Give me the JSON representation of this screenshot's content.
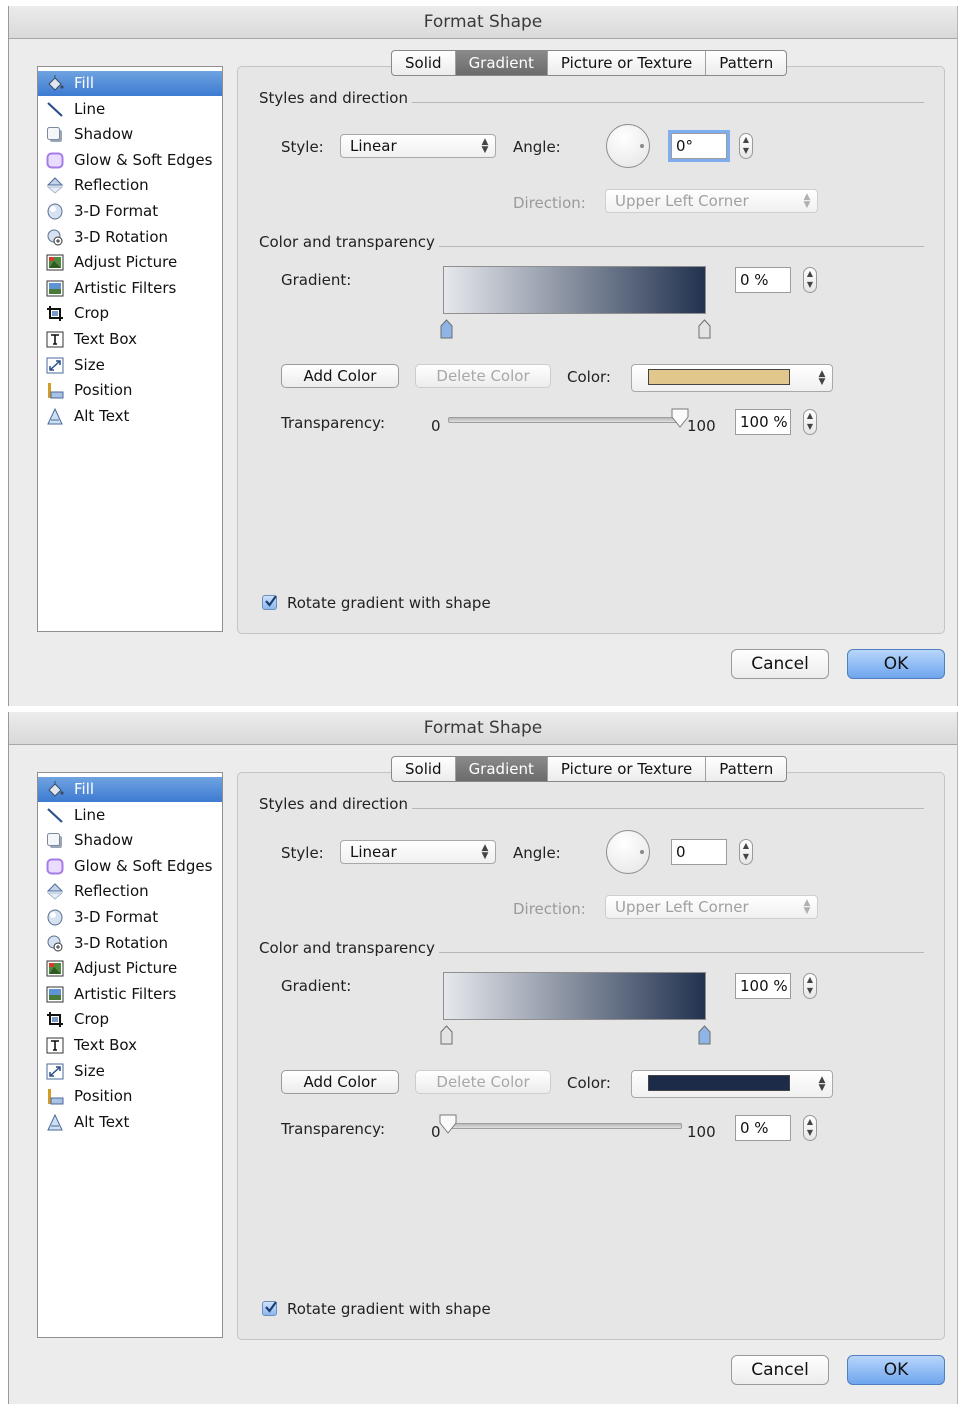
{
  "dialogs": [
    {
      "title": "Format Shape",
      "sidebar": [
        {
          "label": "Fill",
          "icon": "paint-bucket-icon",
          "selected": true
        },
        {
          "label": "Line",
          "icon": "line-icon"
        },
        {
          "label": "Shadow",
          "icon": "shadow-icon"
        },
        {
          "label": "Glow & Soft Edges",
          "icon": "glow-icon"
        },
        {
          "label": "Reflection",
          "icon": "reflection-icon"
        },
        {
          "label": "3-D Format",
          "icon": "3d-format-icon"
        },
        {
          "label": "3-D Rotation",
          "icon": "3d-rotation-icon"
        },
        {
          "label": "Adjust Picture",
          "icon": "adjust-picture-icon"
        },
        {
          "label": "Artistic Filters",
          "icon": "artistic-filters-icon"
        },
        {
          "label": "Crop",
          "icon": "crop-icon"
        },
        {
          "label": "Text Box",
          "icon": "text-box-icon"
        },
        {
          "label": "Size",
          "icon": "size-icon"
        },
        {
          "label": "Position",
          "icon": "position-icon"
        },
        {
          "label": "Alt Text",
          "icon": "alt-text-icon"
        }
      ],
      "tabs": [
        {
          "label": "Solid"
        },
        {
          "label": "Gradient",
          "selected": true
        },
        {
          "label": "Picture or Texture"
        },
        {
          "label": "Pattern"
        }
      ],
      "styles_section": "Styles and direction",
      "style_label": "Style:",
      "style_value": "Linear",
      "angle_label": "Angle:",
      "angle_value": "0°",
      "direction_label": "Direction:",
      "direction_value": "Upper Left Corner",
      "color_section": "Color and transparency",
      "gradient_label": "Gradient:",
      "stop_position": "0 %",
      "selected_stop": 0,
      "add_color": "Add Color",
      "delete_color": "Delete Color",
      "color_label": "Color:",
      "color_swatch": "#e2c78c",
      "transparency_label": "Transparency:",
      "transparency_min": "0",
      "transparency_max": "100",
      "transparency_value": "100 %",
      "transparency_level": 1.0,
      "rotate_label": "Rotate gradient with shape",
      "rotate_checked": true,
      "cancel": "Cancel",
      "ok": "OK"
    },
    {
      "title": "Format Shape",
      "sidebar": [
        {
          "label": "Fill",
          "icon": "paint-bucket-icon",
          "selected": true
        },
        {
          "label": "Line",
          "icon": "line-icon"
        },
        {
          "label": "Shadow",
          "icon": "shadow-icon"
        },
        {
          "label": "Glow & Soft Edges",
          "icon": "glow-icon"
        },
        {
          "label": "Reflection",
          "icon": "reflection-icon"
        },
        {
          "label": "3-D Format",
          "icon": "3d-format-icon"
        },
        {
          "label": "3-D Rotation",
          "icon": "3d-rotation-icon"
        },
        {
          "label": "Adjust Picture",
          "icon": "adjust-picture-icon"
        },
        {
          "label": "Artistic Filters",
          "icon": "artistic-filters-icon"
        },
        {
          "label": "Crop",
          "icon": "crop-icon"
        },
        {
          "label": "Text Box",
          "icon": "text-box-icon"
        },
        {
          "label": "Size",
          "icon": "size-icon"
        },
        {
          "label": "Position",
          "icon": "position-icon"
        },
        {
          "label": "Alt Text",
          "icon": "alt-text-icon"
        }
      ],
      "tabs": [
        {
          "label": "Solid"
        },
        {
          "label": "Gradient",
          "selected": true
        },
        {
          "label": "Picture or Texture"
        },
        {
          "label": "Pattern"
        }
      ],
      "styles_section": "Styles and direction",
      "style_label": "Style:",
      "style_value": "Linear",
      "angle_label": "Angle:",
      "angle_value": "0",
      "direction_label": "Direction:",
      "direction_value": "Upper Left Corner",
      "color_section": "Color and transparency",
      "gradient_label": "Gradient:",
      "stop_position": "100 %",
      "selected_stop": 1,
      "add_color": "Add Color",
      "delete_color": "Delete Color",
      "color_label": "Color:",
      "color_swatch": "#1c2b48",
      "transparency_label": "Transparency:",
      "transparency_min": "0",
      "transparency_max": "100",
      "transparency_value": "0 %",
      "transparency_level": 0.0,
      "rotate_label": "Rotate gradient with shape",
      "rotate_checked": true,
      "cancel": "Cancel",
      "ok": "OK"
    }
  ],
  "gradient_colors": {
    "start": "#e6e8ec",
    "end": "#22324f"
  }
}
